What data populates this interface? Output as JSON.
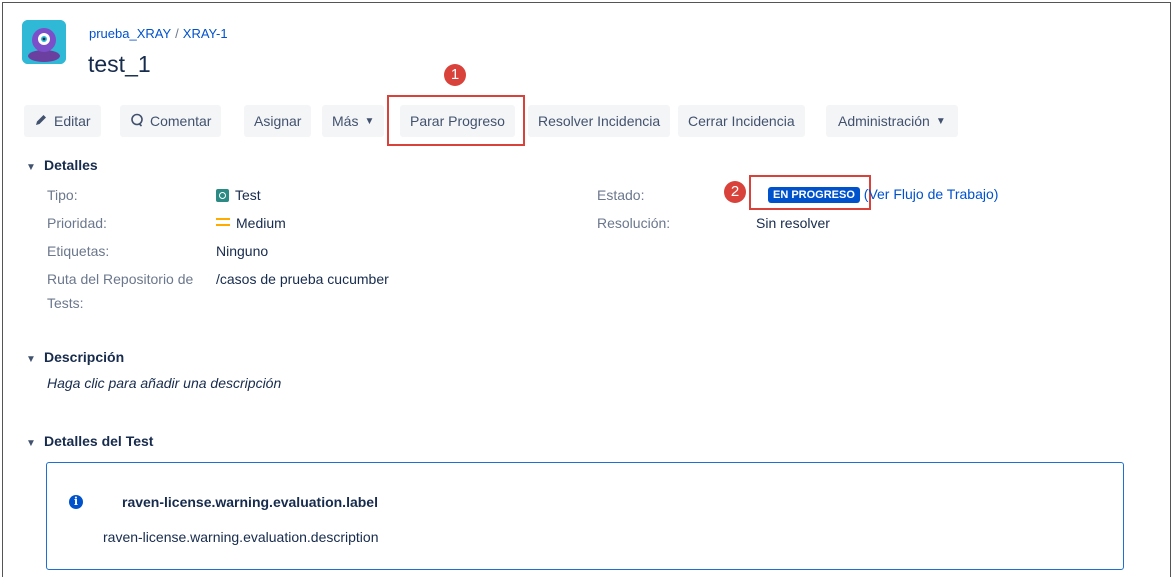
{
  "header": {
    "project_link": "prueba_XRAY",
    "separator": "/",
    "issue_key": "XRAY-1",
    "issue_title": "test_1"
  },
  "toolbar": {
    "edit": "Editar",
    "comment": "Comentar",
    "assign": "Asignar",
    "more": "Más",
    "stop_progress": "Parar Progreso",
    "resolve": "Resolver Incidencia",
    "close": "Cerrar Incidencia",
    "admin": "Administración"
  },
  "callouts": {
    "one": "1",
    "two": "2"
  },
  "details": {
    "heading": "Detalles",
    "type_label": "Tipo:",
    "type_value": "Test",
    "priority_label": "Prioridad:",
    "priority_value": "Medium",
    "labels_label": "Etiquetas:",
    "labels_value": "Ninguno",
    "repo_label_line1": "Ruta del Repositorio de",
    "repo_label_line2": "Tests:",
    "repo_value": "/casos de prueba cucumber",
    "status_label": "Estado:",
    "status_value": "EN PROGRESO",
    "workflow_link": "(Ver Flujo de Trabajo)",
    "resolution_label": "Resolución:",
    "resolution_value": "Sin resolver"
  },
  "description": {
    "heading": "Descripción",
    "placeholder": "Haga clic para añadir una descripción"
  },
  "test_details": {
    "heading": "Detalles del Test",
    "info_title": "raven-license.warning.evaluation.label",
    "info_description": "raven-license.warning.evaluation.description"
  },
  "colors": {
    "accent": "#0052cc",
    "callout": "#d9423b",
    "button_bg": "#f4f5f7",
    "priority": "#ffab00"
  }
}
